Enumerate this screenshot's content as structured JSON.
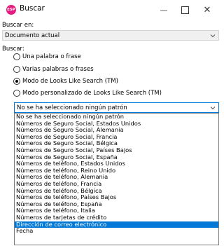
{
  "window": {
    "title": "Buscar",
    "app_icon_text": "ESP",
    "minimize_glyph": "—",
    "close_glyph": "✕"
  },
  "search_in": {
    "label": "Buscar en:",
    "value": "Documento actual"
  },
  "search": {
    "label": "Buscar:",
    "options": [
      {
        "label": "Una palabra o frase",
        "checked": false
      },
      {
        "label": "Varias palabras o frases",
        "checked": false
      },
      {
        "label": "Modo de Looks Like Search (TM)",
        "checked": true
      },
      {
        "label": "Modo personalizado de Looks Like Search (TM)",
        "checked": false
      }
    ]
  },
  "pattern": {
    "value": "No se ha seleccionado ningún patrón",
    "items": [
      "No se ha seleccionado ningún patrón",
      "Números de Seguro Social, Estados Unidos",
      "Números de Seguro Social, Alemania",
      "Números de Seguro Social, Francia",
      "Números de Seguro Social, Bélgica",
      "Números de Seguro Social, Países Bajos",
      "Números de Seguro Social, España",
      "Números de teléfono, Estados Unidos",
      "Números de teléfono, Reino Unido",
      "Números de teléfono, Alemania",
      "Números de teléfono, Francia",
      "Números de teléfono, Bélgica",
      "Números de teléfono, Países Bajos",
      "Números de teléfono, España",
      "Números de teléfono, Italia",
      "Números de tarjetas de crédito",
      "Dirección de correo electrónico",
      "Fecha"
    ],
    "selected_index": 16
  },
  "colors": {
    "selection": "#0078d7",
    "app_icon": "#e6197e"
  }
}
